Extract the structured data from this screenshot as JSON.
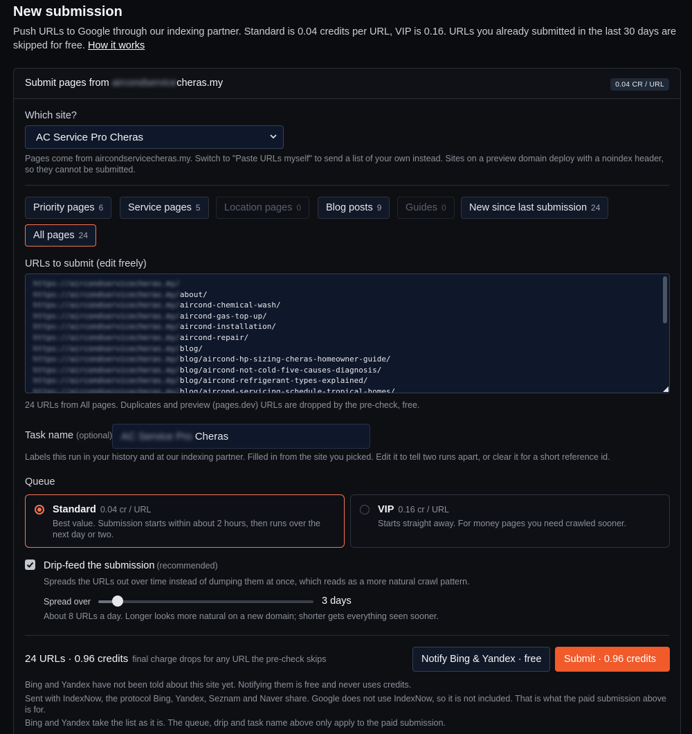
{
  "page": {
    "title": "New submission",
    "intro": "Push URLs to Google through our indexing partner. Standard is 0.04 credits per URL, VIP is 0.16. URLs you already submitted in the last 30 days are skipped for free.",
    "how_it_works": "How it works"
  },
  "card": {
    "title_prefix": "Submit pages from",
    "domain_blurred": "aircondservice",
    "domain_visible": "cheras.my",
    "rate_badge": "0.04 CR / URL"
  },
  "site": {
    "label": "Which site?",
    "selected": "AC Service Pro Cheras",
    "hint": "Pages come from aircondservicecheras.my. Switch to \"Paste URLs myself\" to send a list of your own instead. Sites on a preview domain deploy with a noindex header, so they cannot be submitted."
  },
  "filters": [
    {
      "label": "Priority pages",
      "count": "6"
    },
    {
      "label": "Service pages",
      "count": "5"
    },
    {
      "label": "Location pages",
      "count": "0"
    },
    {
      "label": "Blog posts",
      "count": "9"
    },
    {
      "label": "Guides",
      "count": "0"
    },
    {
      "label": "New since last submission",
      "count": "24"
    },
    {
      "label": "All pages",
      "count": "24"
    }
  ],
  "urls": {
    "label": "URLs to submit (edit freely)",
    "domain_blurred": "https://aircondservicecheras.my/",
    "paths": [
      "",
      "about/",
      "aircond-chemical-wash/",
      "aircond-gas-top-up/",
      "aircond-installation/",
      "aircond-repair/",
      "blog/",
      "blog/aircond-hp-sizing-cheras-homeowner-guide/",
      "blog/aircond-not-cold-five-causes-diagnosis/",
      "blog/aircond-refrigerant-types-explained/",
      "blog/aircond-servicing-schedule-tropical-homes/"
    ],
    "hint": "24 URLs from All pages. Duplicates and preview (pages.dev) URLs are dropped by the pre-check, free."
  },
  "task": {
    "label": "Task name",
    "optional": "(optional)",
    "value_blurred": "AC Service Pro",
    "value_visible": "Cheras",
    "hint": "Labels this run in your history and at our indexing partner. Filled in from the site you picked. Edit it to tell two runs apart, or clear it for a short reference id."
  },
  "queue": {
    "label": "Queue",
    "options": [
      {
        "name": "Standard",
        "rate": "0.04 cr / URL",
        "desc": "Best value. Submission starts within about 2 hours, then runs over the next day or two.",
        "selected": true
      },
      {
        "name": "VIP",
        "rate": "0.16 cr / URL",
        "desc": "Starts straight away. For money pages you need crawled sooner.",
        "selected": false
      }
    ]
  },
  "drip": {
    "title": "Drip-feed the submission",
    "recommended": "(recommended)",
    "checked": true,
    "desc": "Spreads the URLs out over time instead of dumping them at once, which reads as a more natural crawl pattern.",
    "spread_label": "Spread over",
    "spread_value": "3 days",
    "spread_fraction": 0.09,
    "hint": "About 8 URLs a day. Longer looks more natural on a new domain; shorter gets everything seen sooner."
  },
  "summary": {
    "text": "24 URLs · 0.96 credits",
    "note": "final charge drops for any URL the pre-check skips",
    "notify_button": "Notify Bing & Yandex · free",
    "submit_button": "Submit · 0.96 credits"
  },
  "footer_notes": [
    "Bing and Yandex have not been told about this site yet. Notifying them is free and never uses credits.",
    "Sent with IndexNow, the protocol Bing, Yandex, Seznam and Naver share. Google does not use IndexNow, so it is not included. That is what the paid submission above is for.",
    "Bing and Yandex take the list as it is. The queue, drip and task name above only apply to the paid submission."
  ],
  "colors": {
    "accent": "#f15a2b",
    "background": "#0b0c0f",
    "input_bg": "#0f172a"
  }
}
